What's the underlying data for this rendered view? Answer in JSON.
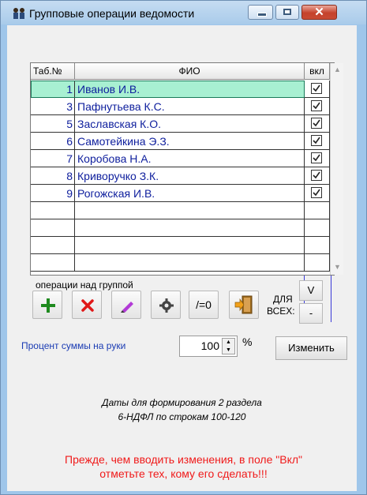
{
  "window": {
    "title": "Групповые операции ведомости",
    "close_glyph": "✕"
  },
  "grid": {
    "columns": [
      "Таб.№",
      "ФИО",
      "вкл"
    ],
    "rows": [
      {
        "tab": "1",
        "fio": "Иванов И.В.",
        "checked": true
      },
      {
        "tab": "3",
        "fio": "Пафнутьева К.С.",
        "checked": true
      },
      {
        "tab": "5",
        "fio": "Заславская К.О.",
        "checked": true
      },
      {
        "tab": "6",
        "fio": "Самотейкина Э.З.",
        "checked": true
      },
      {
        "tab": "7",
        "fio": "Коробова Н.А.",
        "checked": true
      },
      {
        "tab": "8",
        "fio": "Криворучко З.К.",
        "checked": true
      },
      {
        "tab": "9",
        "fio": "Рогожская И.В.",
        "checked": true
      }
    ],
    "empty_rows": 4,
    "selected_row_index": 0
  },
  "operations": {
    "label": "операции над группой",
    "buttons": [
      {
        "name": "add-button",
        "icon": "plus-icon"
      },
      {
        "name": "delete-button",
        "icon": "cross-icon"
      },
      {
        "name": "edit-button",
        "icon": "pencil-icon"
      },
      {
        "name": "settings-button",
        "icon": "gear-icon"
      },
      {
        "name": "zero-button",
        "text": "/=0"
      },
      {
        "name": "exit-button",
        "icon": "door-exit-icon"
      }
    ],
    "for_all_label_1": "ДЛЯ",
    "for_all_label_2": "ВСЕХ:",
    "check_all_label": "V",
    "uncheck_all_label": "-"
  },
  "percent": {
    "label": "Процент суммы на руки",
    "value": "100",
    "unit": "%",
    "change_button": "Изменить"
  },
  "dates_note": {
    "line1": "Даты для формирования 2  раздела",
    "line2": "6-НДФЛ по строкам  100-120"
  },
  "warning": {
    "line1": "Прежде, чем вводить изменения, в поле \"Вкл\"",
    "line2": "отметьте тех, кому его сделать!!!"
  },
  "colors": {
    "selected_row": "#a8f0d2",
    "name_text": "#10209e",
    "warning_text": "#f01a1a",
    "percent_label": "#1a3bb3"
  }
}
